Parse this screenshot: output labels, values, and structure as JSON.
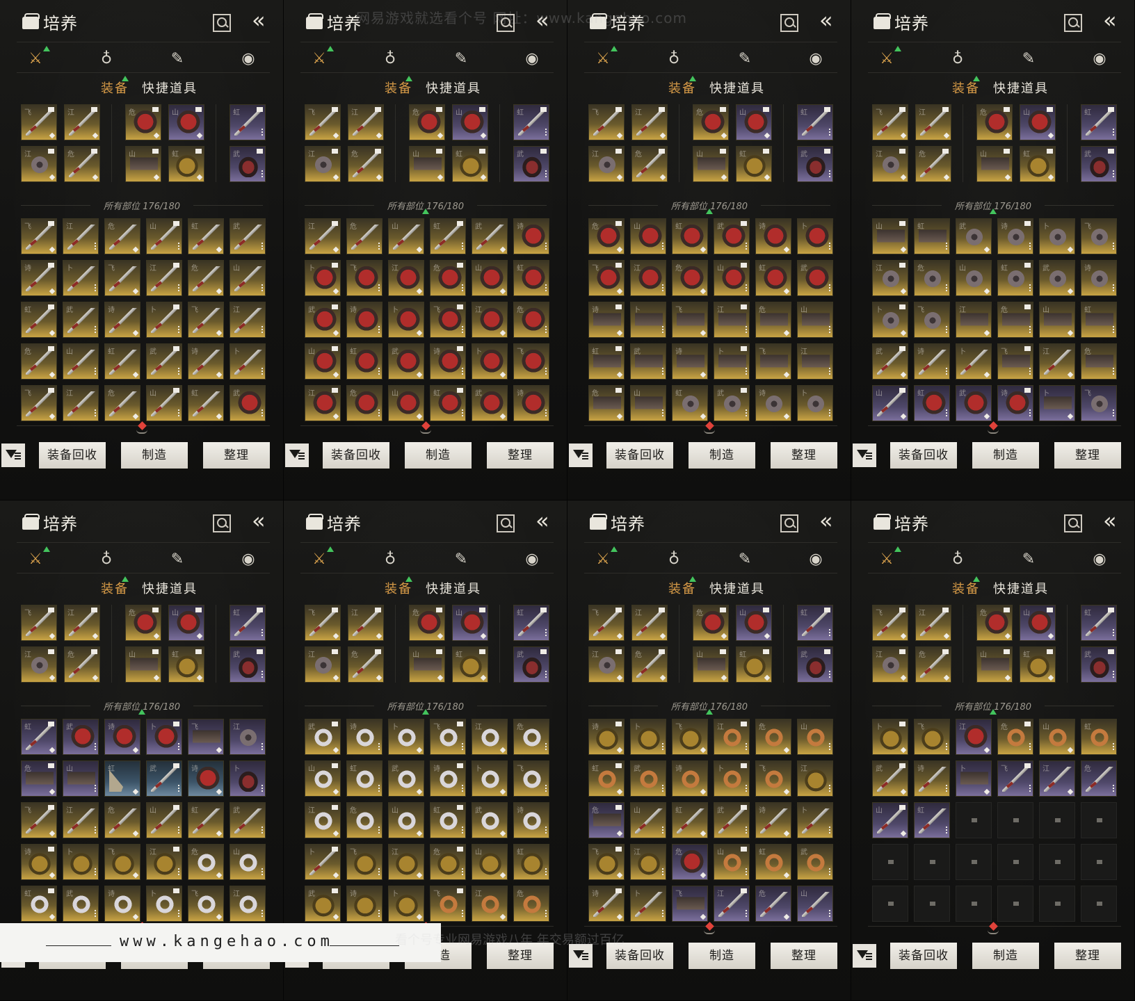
{
  "screen": {
    "title": "培养",
    "tabs": {
      "equipment": "装备",
      "quick_items": "快捷道具"
    },
    "count_label": "所有部位",
    "count_value": "176/180",
    "buttons": {
      "recycle": "装备回收",
      "craft": "制造",
      "sort": "整理"
    },
    "category_icons": [
      "crossed-swords-icon",
      "pouch-icon",
      "scroll-icon",
      "cooking-pot-icon"
    ]
  },
  "colors": {
    "accent": "#d69a47",
    "upgrade": "#43c45d",
    "highlight": "#e0423a"
  },
  "watermarks": {
    "top": "网易游戏就选看个号  网址：www.kangehao.com",
    "footer_url": "www.kangehao.com",
    "bottom": "看个号专业网易游戏八年  年交易额过百亿"
  },
  "equipped_rows": [
    [
      "gold:sword",
      "gold:sword",
      "gold:helm",
      "purple:helm",
      "purple:sword"
    ],
    [
      "gold:disc",
      "gold:sword",
      "gold:gauntlet",
      "gold:armor",
      "purple:cup"
    ]
  ],
  "inventory_pages": [
    [
      "sword",
      "sword",
      "sword",
      "sword",
      "sword",
      "sword",
      "sword",
      "sword",
      "sword",
      "sword",
      "sword",
      "sword",
      "sword",
      "sword",
      "sword",
      "sword",
      "sword",
      "sword",
      "sword",
      "sword",
      "sword",
      "sword",
      "sword",
      "sword",
      "sword",
      "sword",
      "sword",
      "sword",
      "sword",
      "helm"
    ],
    [
      "sword",
      "sword",
      "sword",
      "sword",
      "sword",
      "helm",
      "helm",
      "helm",
      "helm",
      "helm",
      "helm",
      "helm",
      "helm",
      "helm",
      "helm",
      "helm",
      "helm",
      "helm",
      "helm",
      "helm",
      "helm",
      "helm",
      "helm",
      "helm",
      "helm",
      "helm",
      "helm",
      "helm",
      "helm",
      "helm"
    ],
    [
      "helm",
      "helm",
      "helm",
      "helm",
      "helm",
      "helm",
      "helm",
      "helm",
      "helm",
      "helm",
      "helm",
      "helm",
      "gauntlet",
      "gauntlet",
      "gauntlet",
      "gauntlet",
      "gauntlet",
      "gauntlet",
      "gauntlet",
      "gauntlet",
      "gauntlet",
      "gauntlet",
      "gauntlet",
      "gauntlet",
      "gauntlet",
      "gauntlet",
      "disc",
      "disc",
      "disc",
      "disc"
    ],
    [
      "gauntlet",
      "gauntlet",
      "disc",
      "disc",
      "disc",
      "disc",
      "disc",
      "disc",
      "disc",
      "disc",
      "disc",
      "disc",
      "disc",
      "disc",
      "gauntlet",
      "gauntlet",
      "gauntlet",
      "gauntlet",
      "sword",
      "sword",
      "sword",
      "gauntlet",
      "sword",
      "gauntlet",
      "p:sword",
      "p:helm",
      "p:helm",
      "p:helm",
      "p:gauntlet",
      "p:disc"
    ],
    [
      "p:sword",
      "p:helm",
      "p:helm",
      "p:helm",
      "p:gauntlet",
      "p:disc",
      "p:gauntlet",
      "p:gauntlet",
      "b:fan",
      "b:sword",
      "b:helm",
      "p:cup",
      "sword",
      "sword",
      "sword",
      "sword",
      "sword",
      "sword",
      "armor",
      "armor",
      "armor",
      "armor",
      "ring",
      "ring",
      "ring",
      "ring",
      "ring",
      "ring",
      "ring",
      "ring"
    ],
    [
      "ring",
      "ring",
      "ring",
      "ring",
      "ring",
      "ring",
      "ring",
      "ring",
      "ring",
      "ring",
      "ring",
      "ring",
      "ring",
      "ring",
      "ring",
      "ring",
      "ring",
      "ring",
      "sword",
      "armor",
      "armor",
      "armor",
      "armor",
      "armor",
      "armor",
      "armor",
      "armor",
      "ringb",
      "ringb",
      "ringb"
    ],
    [
      "armor",
      "armor",
      "armor",
      "ringb",
      "ringb",
      "ringb",
      "ringb",
      "ringb",
      "ringb",
      "ringb",
      "ringb",
      "armor",
      "p:gauntlet",
      "sword",
      "sword",
      "sword",
      "sword",
      "sword",
      "armor",
      "armor",
      "p:helm",
      "ringb",
      "ringb",
      "ringb",
      "sword",
      "sword",
      "p:gauntlet",
      "p:sword",
      "p:sword",
      "p:sword"
    ],
    [
      "armor",
      "armor",
      "p:helm",
      "ringb",
      "ringb",
      "ringb",
      "sword",
      "sword",
      "p:gauntlet",
      "p:sword",
      "p:sword",
      "p:sword",
      "p:sword",
      "p:sword",
      "empty",
      "empty",
      "empty",
      "empty",
      "empty",
      "empty",
      "empty",
      "empty",
      "empty",
      "empty",
      "empty",
      "empty",
      "empty",
      "empty",
      "empty",
      "empty"
    ]
  ]
}
